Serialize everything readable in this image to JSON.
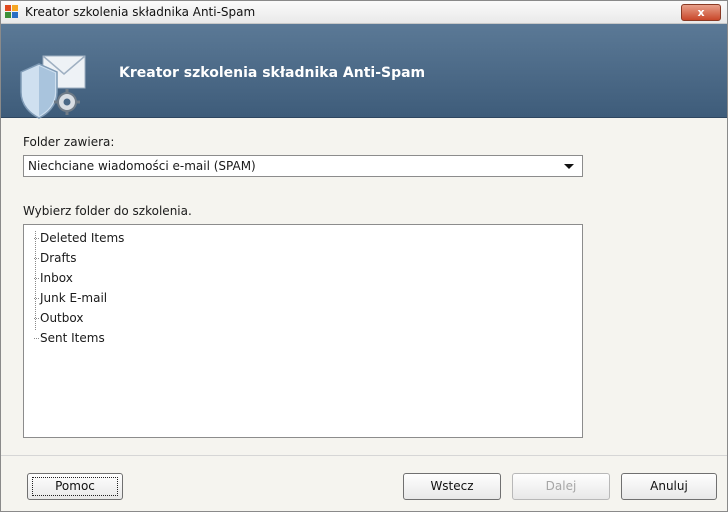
{
  "window": {
    "title": "Kreator szkolenia składnika Anti-Spam",
    "close_label": "x"
  },
  "banner": {
    "title": "Kreator szkolenia składnika Anti-Spam"
  },
  "folder_contains": {
    "label": "Folder zawiera:",
    "selected": "Niechciane wiadomości e-mail (SPAM)"
  },
  "tree": {
    "label": "Wybierz folder do szkolenia.",
    "items": [
      "Deleted Items",
      "Drafts",
      "Inbox",
      "Junk E-mail",
      "Outbox",
      "Sent Items"
    ]
  },
  "buttons": {
    "help": "Pomoc",
    "back": "Wstecz",
    "next": "Dalej",
    "cancel": "Anuluj"
  },
  "colors": {
    "banner": "#4a6886",
    "close": "#c9472a"
  },
  "icons": {
    "app": "avg-logo-icon",
    "banner": "shield-envelope-gear-icon"
  }
}
